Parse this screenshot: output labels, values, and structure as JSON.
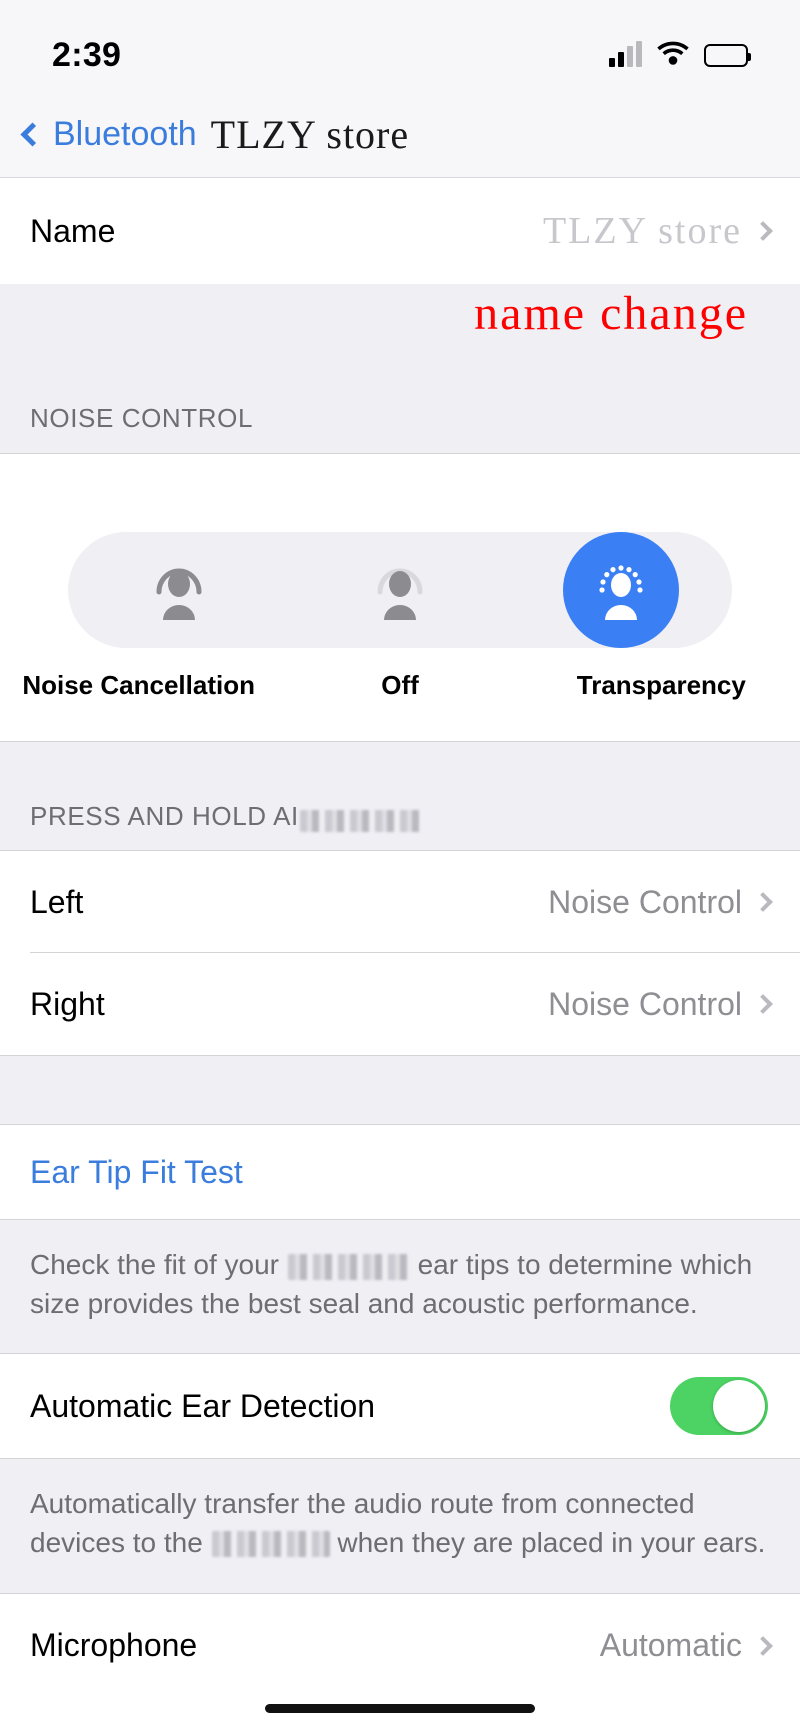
{
  "status_bar": {
    "time": "2:39",
    "cellular_icon": "cellular-bars-icon",
    "wifi_icon": "wifi-icon",
    "battery_icon": "battery-full-icon"
  },
  "nav": {
    "back_label": "Bluetooth",
    "back_icon": "chevron-left-icon",
    "title": "TLZY store"
  },
  "name_row": {
    "label": "Name",
    "value": "TLZY store",
    "chevron_icon": "chevron-right-icon"
  },
  "annotation": {
    "text": "name change",
    "color": "#ff0000"
  },
  "noise_control": {
    "section_header": "NOISE CONTROL",
    "selected": "Transparency",
    "accent_color": "#3b7ff5",
    "options": [
      {
        "label": "Noise Cancellation",
        "icon": "person-noise-cancellation-icon",
        "selected": false
      },
      {
        "label": "Off",
        "icon": "person-noise-off-icon",
        "selected": false
      },
      {
        "label": "Transparency",
        "icon": "person-transparency-icon",
        "selected": true
      }
    ]
  },
  "press_and_hold": {
    "header_prefix": "PRESS AND HOLD AI",
    "header_redacted": true,
    "rows": [
      {
        "label": "Left",
        "value": "Noise Control",
        "chevron_icon": "chevron-right-icon"
      },
      {
        "label": "Right",
        "value": "Noise Control",
        "chevron_icon": "chevron-right-icon"
      }
    ]
  },
  "ear_tip_fit_test": {
    "link_label": "Ear Tip Fit Test",
    "link_color": "#3b7ddd",
    "note_before": "Check the fit of your ",
    "note_after": " ear tips to determine which size provides the best seal and acoustic performance."
  },
  "automatic_ear_detection": {
    "label": "Automatic Ear Detection",
    "toggle_state": "on",
    "toggle_color": "#4cd363",
    "note_before": "Automatically transfer the audio route from connected devices to the ",
    "note_after": " when they are placed in your ears."
  },
  "microphone": {
    "label": "Microphone",
    "value": "Automatic",
    "chevron_icon": "chevron-right-icon"
  },
  "home_indicator": "home-indicator"
}
